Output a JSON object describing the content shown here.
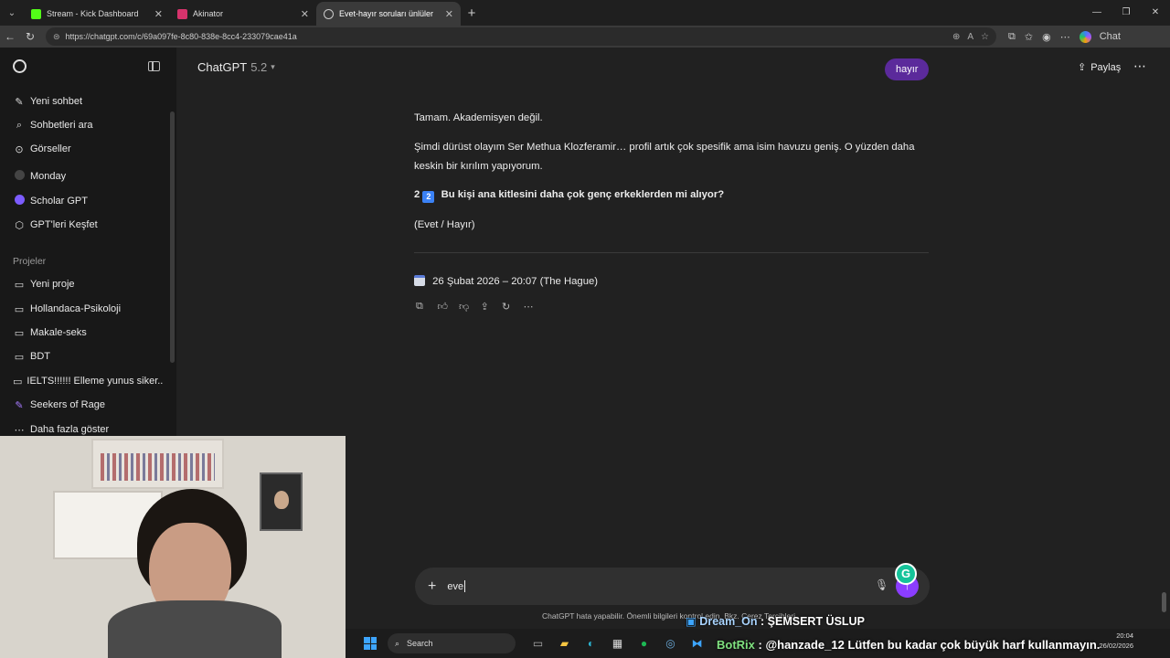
{
  "browser": {
    "tabs": [
      {
        "title": "Stream - Kick Dashboard",
        "color": "#53fc18"
      },
      {
        "title": "Akinator",
        "color": "#d6336c"
      },
      {
        "title": "Evet-hayır soruları ünlüler",
        "color": "#cccccc"
      }
    ],
    "url": "https://chatgpt.com/c/69a097fe-8c80-838e-8cc4-233079cae41a",
    "copilot_label": "Chat"
  },
  "sidebar": {
    "items": [
      {
        "label": "Yeni sohbet",
        "icon": "edit-icon"
      },
      {
        "label": "Sohbetleri ara",
        "icon": "search-icon"
      },
      {
        "label": "Görseller",
        "icon": "image-icon"
      },
      {
        "label": "Monday",
        "icon": "monday-icon"
      },
      {
        "label": "Scholar GPT",
        "icon": "scholar-icon"
      },
      {
        "label": "GPT'leri Keşfet",
        "icon": "cube-icon"
      }
    ],
    "projects_title": "Projeler",
    "projects": [
      {
        "label": "Yeni proje",
        "icon": "folder-plus-icon"
      },
      {
        "label": "Hollandaca-Psikoloji",
        "icon": "folder-icon"
      },
      {
        "label": "Makale-seks",
        "icon": "folder-icon"
      },
      {
        "label": "BDT",
        "icon": "folder-icon"
      },
      {
        "label": "IELTS!!!!!! Elleme yunus siker...",
        "icon": "folder-icon"
      },
      {
        "label": "Seekers of Rage",
        "icon": "feather-icon"
      }
    ],
    "more_label": "Daha fazla göster"
  },
  "header": {
    "model": "ChatGPT",
    "version": "5.2",
    "share_label": "Paylaş"
  },
  "chat": {
    "user_message": "hayır",
    "para1": "Tamam. Akademisyen değil.",
    "para2": "Şimdi dürüst olayım Ser Methua Klozferamir… profil artık çok spesifik ama isim havuzu geniş. O yüzden daha keskin bir kırılım yapıyorum.",
    "question_num": "2",
    "question_badge": "2",
    "question": "Bu kişi ana kitlesini daha çok genç erkeklerden mi alıyor?",
    "options": "(Evet / Hayır)",
    "timestamp": "26 Şubat 2026 – 20:07 (The Hague)"
  },
  "composer": {
    "value": "eve",
    "disclaimer": "ChatGPT hata yapabilir. Önemli bilgileri kontrol edin. Bkz. Çerez Tercihleri."
  },
  "overlay": {
    "line1_name": "Dream_On",
    "line1_text": ": ŞEMSERT ÜSLUP",
    "line2_name": "BotRix",
    "line2_text": ": @hanzade_12 Lütfen bu kadar çok büyük harf kullanmayın."
  },
  "taskbar": {
    "search_label": "Search",
    "time": "20:04",
    "date": "26/02/2026"
  }
}
